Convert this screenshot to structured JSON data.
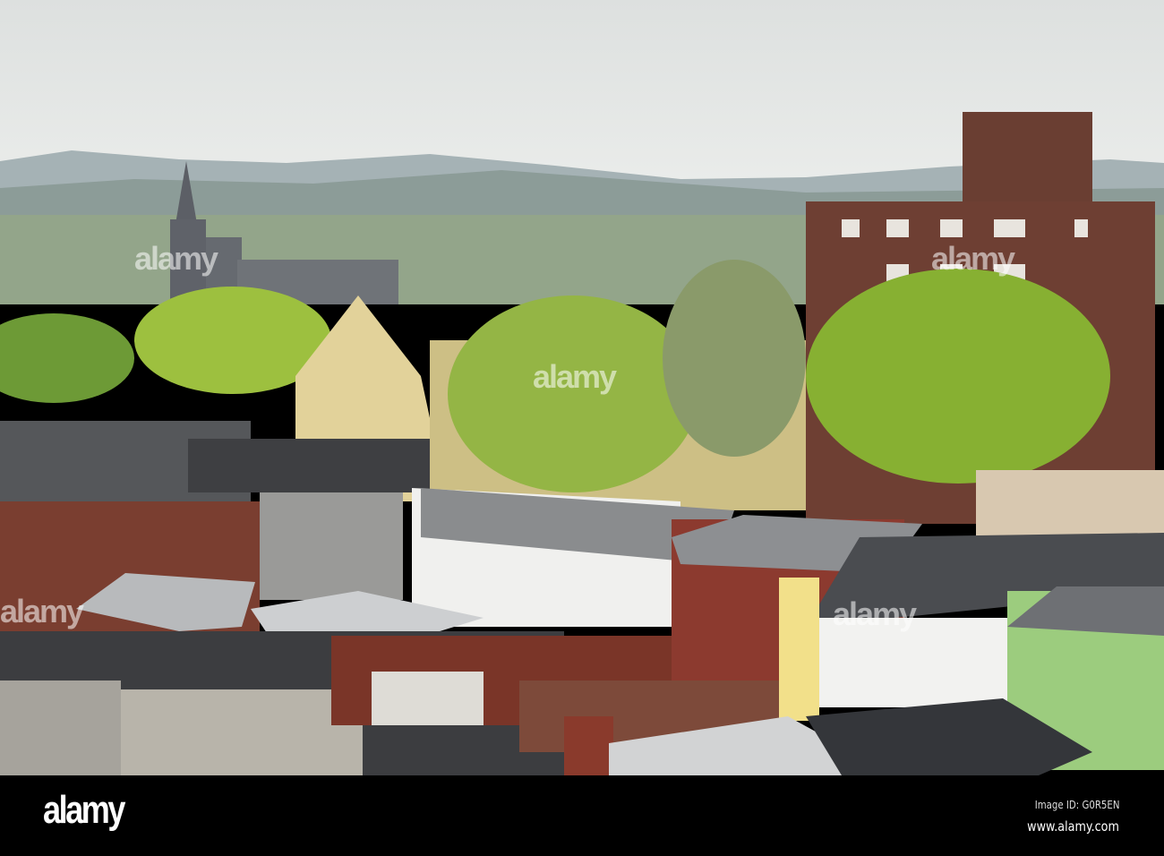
{
  "photo": {
    "subject": "Rooftops and buildings of a small town with hills in the distance",
    "watermark_text": "alamy"
  },
  "footer": {
    "logo": "alamy",
    "image_id": "Image ID: G0R5EN",
    "url": "www.alamy.com"
  },
  "colors": {
    "sky": "#e6e8e6",
    "hills": "#8fa0a5",
    "trees": "#8fb23a",
    "brick": "#7a3a2e",
    "footer": "#000000"
  }
}
